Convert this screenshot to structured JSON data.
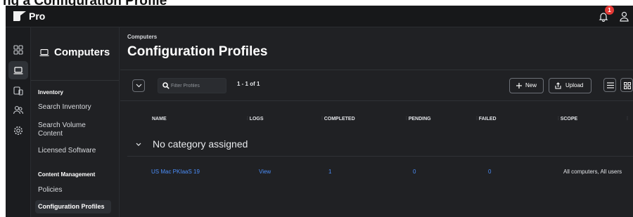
{
  "clipped_heading": "ng a Configuration Profile",
  "app": {
    "brand": "Pro",
    "notification_count": "1"
  },
  "sidebar": {
    "title": "Computers",
    "sections": [
      {
        "label": "Inventory",
        "items": [
          "Search Inventory",
          "Search Volume Content",
          "Licensed Software"
        ]
      },
      {
        "label": "Content Management",
        "items": [
          "Policies",
          "Configuration Profiles"
        ]
      }
    ]
  },
  "main": {
    "breadcrumb": "Computers",
    "title": "Configuration Profiles",
    "filter_placeholder": "Filter Profiles",
    "count": "1 - 1 of 1",
    "new_label": "New",
    "upload_label": "Upload",
    "columns": [
      "NAME",
      "LOGS",
      "COMPLETED",
      "PENDING",
      "FAILED",
      "SCOPE"
    ],
    "category": "No category assigned",
    "rows": [
      {
        "name": "US Mac PKIaaS 19",
        "logs": "View",
        "completed": "1",
        "pending": "0",
        "failed": "0",
        "scope": "All computers, All users"
      }
    ]
  },
  "colors": {
    "background": "#202124",
    "link": "#4b8df8",
    "badge": "#e53935"
  }
}
